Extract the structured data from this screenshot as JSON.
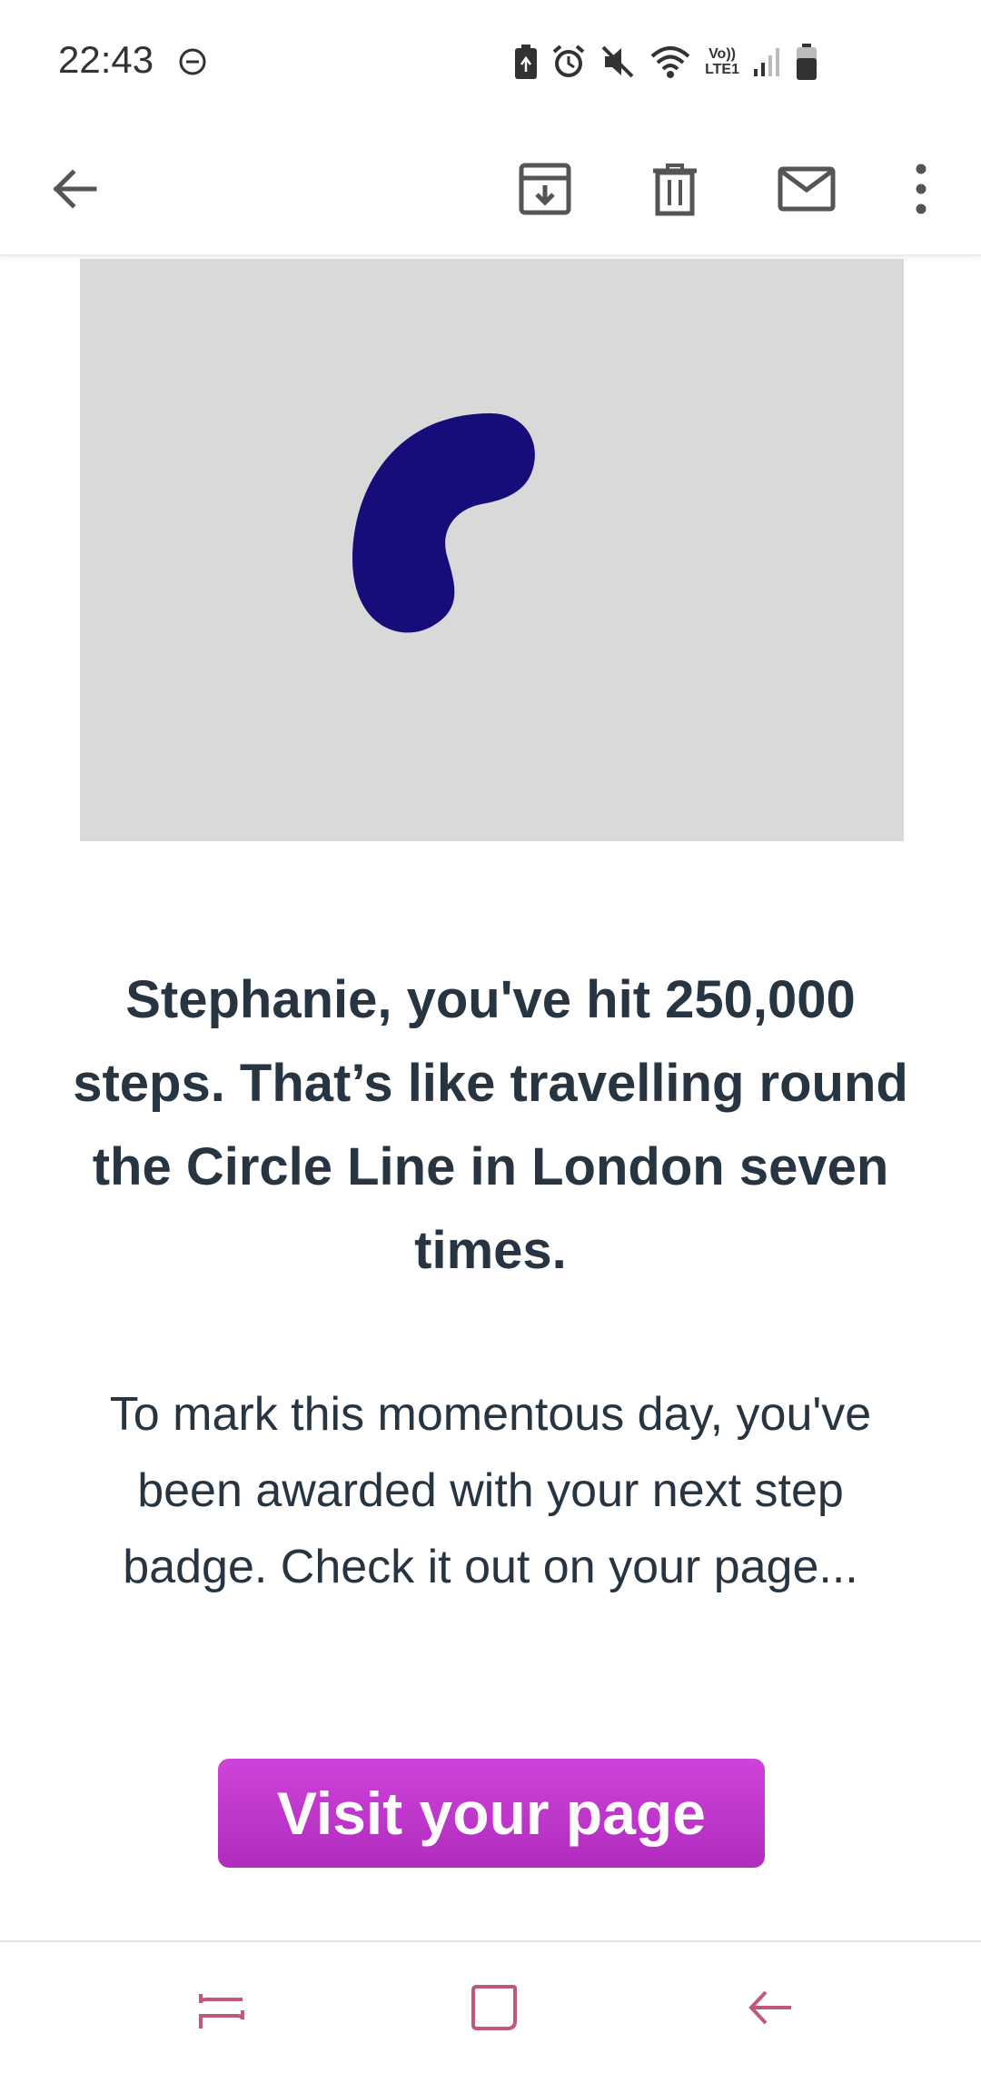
{
  "status_bar": {
    "time": "22:43",
    "icons": [
      "do-not-disturb-icon",
      "battery-saver-icon",
      "alarm-icon",
      "mute-icon",
      "wifi-icon",
      "volte-icon",
      "signal-icon",
      "battery-icon"
    ],
    "volte_label_top": "Vo))",
    "volte_label_bottom": "LTE1"
  },
  "toolbar": {
    "icons": [
      "back-arrow-icon",
      "archive-icon",
      "delete-icon",
      "mail-icon",
      "more-vert-icon"
    ]
  },
  "email": {
    "hero_image": "blue-bean-shape",
    "headline": "Stephanie, you've hit 250,000 steps. That’s like travelling round the Circle Line in London seven times.",
    "body": "To mark this momentous day, you've been awarded with your next step badge. Check it out on your page...",
    "cta_label": "Visit your page"
  },
  "nav_bar": {
    "icons": [
      "recents-icon",
      "home-icon",
      "back-icon"
    ]
  },
  "colors": {
    "text": "#263541",
    "hero_bg": "#d9d9d9",
    "bean": "#160c7a",
    "cta": "#c23ad0",
    "nav_icon": "#c0587a"
  }
}
